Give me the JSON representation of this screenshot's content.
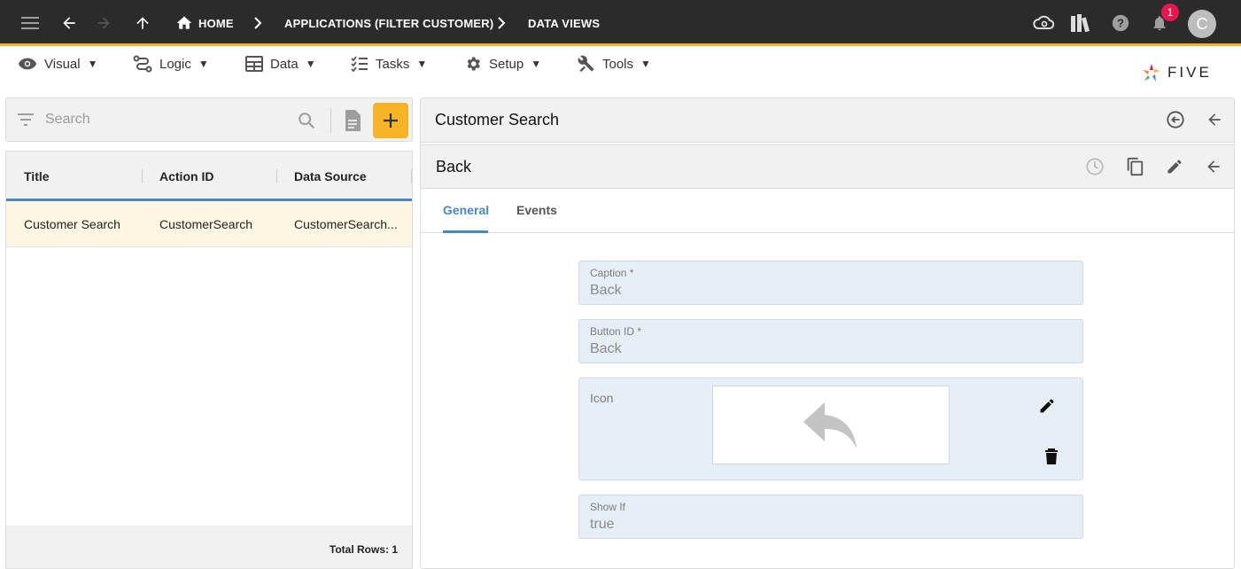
{
  "topbar": {
    "breadcrumbs": [
      "HOME",
      "APPLICATIONS (FILTER CUSTOMER)",
      "DATA VIEWS"
    ],
    "notification_count": "1",
    "avatar_initial": "C"
  },
  "menu": {
    "items": [
      {
        "label": "Visual",
        "icon": "eye-icon"
      },
      {
        "label": "Logic",
        "icon": "logic-flow-icon"
      },
      {
        "label": "Data",
        "icon": "table-icon"
      },
      {
        "label": "Tasks",
        "icon": "checklist-icon"
      },
      {
        "label": "Setup",
        "icon": "gear-icon"
      },
      {
        "label": "Tools",
        "icon": "tools-icon"
      }
    ],
    "dropdown_glyph": "▼"
  },
  "logo": {
    "text": "FIVE"
  },
  "left": {
    "search_placeholder": "Search",
    "columns": [
      "Title",
      "Action ID",
      "Data Source"
    ],
    "rows": [
      {
        "title": "Customer Search",
        "action_id": "CustomerSearch",
        "data_source": "CustomerSearch..."
      }
    ],
    "total_rows": "Total Rows: 1"
  },
  "right": {
    "title": "Customer Search",
    "subtitle": "Back",
    "tabs": [
      "General",
      "Events"
    ],
    "active_tab": "General",
    "fields": {
      "caption": {
        "label": "Caption *",
        "value": "Back"
      },
      "button_id": {
        "label": "Button ID *",
        "value": "Back"
      },
      "icon": {
        "label": "Icon"
      },
      "show_if": {
        "label": "Show If",
        "value": "true"
      }
    }
  },
  "colors": {
    "topbar_bg": "#2b2b2b",
    "accent": "#f6b426",
    "tab_active": "#4a86c8",
    "badge": "#e5174e",
    "field_bg": "#e6eef6",
    "selected_row": "#fdf6e3"
  }
}
